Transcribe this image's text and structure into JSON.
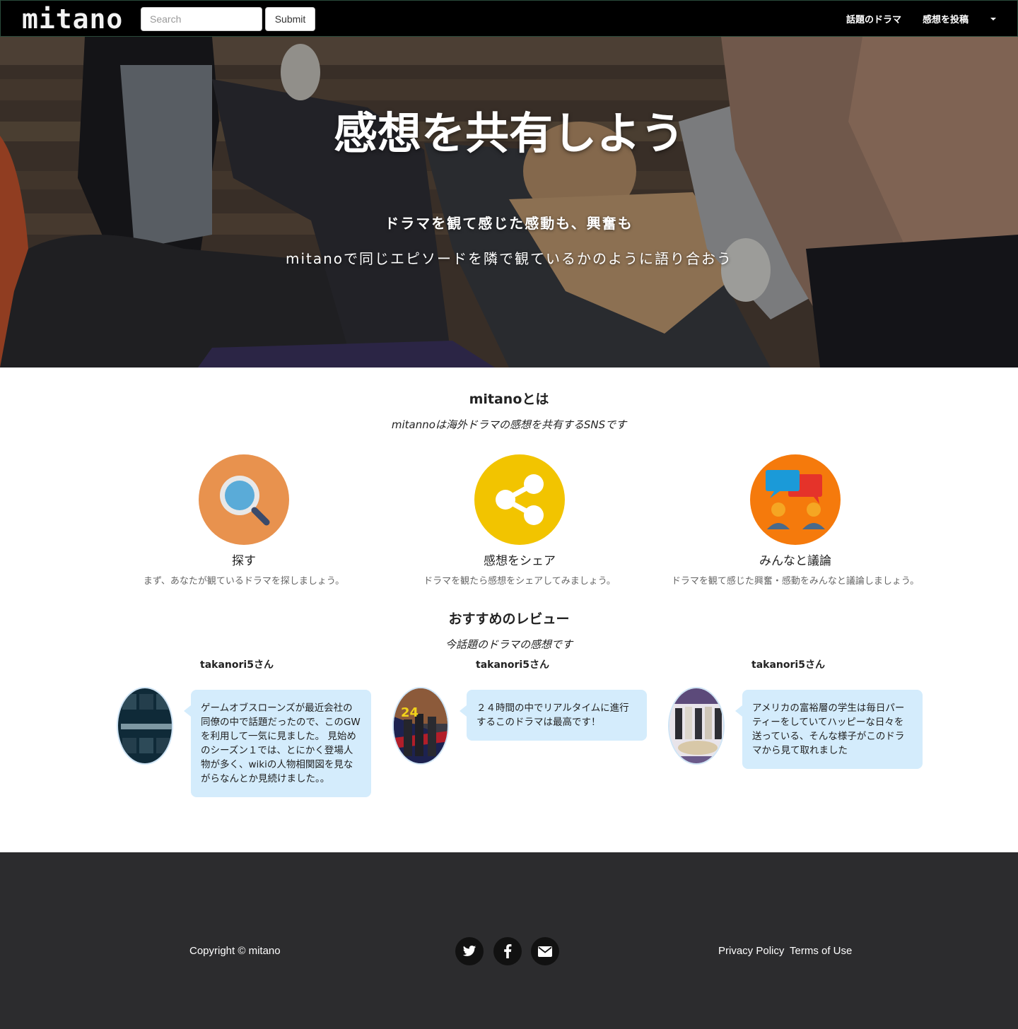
{
  "navbar": {
    "logo": "mitano",
    "search_placeholder": "Search",
    "submit_label": "Submit",
    "links": [
      "話題のドラマ",
      "感想を投稿"
    ]
  },
  "hero": {
    "title": "感想を共有しよう",
    "line1": "ドラマを観て感じた感動も、興奮も",
    "line2": "mitanoで同じエピソードを隣で観ているかのように語り合おう"
  },
  "about": {
    "title": "mitanoとは",
    "subtitle": "mitannoは海外ドラマの感想を共有するSNSです",
    "features": [
      {
        "icon": "search-icon",
        "title": "探す",
        "desc": "まず、あなたが観ているドラマを探しましょう。",
        "color": "#e8924e"
      },
      {
        "icon": "share-icon",
        "title": "感想をシェア",
        "desc": "ドラマを観たら感想をシェアしてみましょう。",
        "color": "#f2c400"
      },
      {
        "icon": "discussion-icon",
        "title": "みんなと議論",
        "desc": "ドラマを観て感じた興奮・感動をみんなと議論しましょう。",
        "color": "#f57a0c"
      }
    ]
  },
  "reviews": {
    "title": "おすすめのレビュー",
    "subtitle": "今話題のドラマの感想です",
    "items": [
      {
        "user": "takanori5さん",
        "poster": "game-of-thrones-poster",
        "text": "ゲームオブスローンズが最近会社の同僚の中で話題だったので、このGWを利用して一気に見ました。 見始めのシーズン１では、とにかく登場人物が多く、wikiの人物相関図を見ながらなんとか見続けました。。"
      },
      {
        "user": "takanori5さん",
        "poster": "24-poster",
        "text": "２４時間の中でリアルタイムに進行するこのドラマは最高です！"
      },
      {
        "user": "takanori5さん",
        "poster": "gossip-girl-poster",
        "text": "アメリカの富裕層の学生は毎日パーティーをしていてハッピーな日々を送っている、そんな様子がこのドラマから見て取れました"
      }
    ]
  },
  "footer": {
    "copyright": "Copyright © mitano",
    "social": [
      "twitter-icon",
      "facebook-icon",
      "envelope-icon"
    ],
    "links": [
      "Privacy Policy",
      "Terms of Use"
    ]
  }
}
